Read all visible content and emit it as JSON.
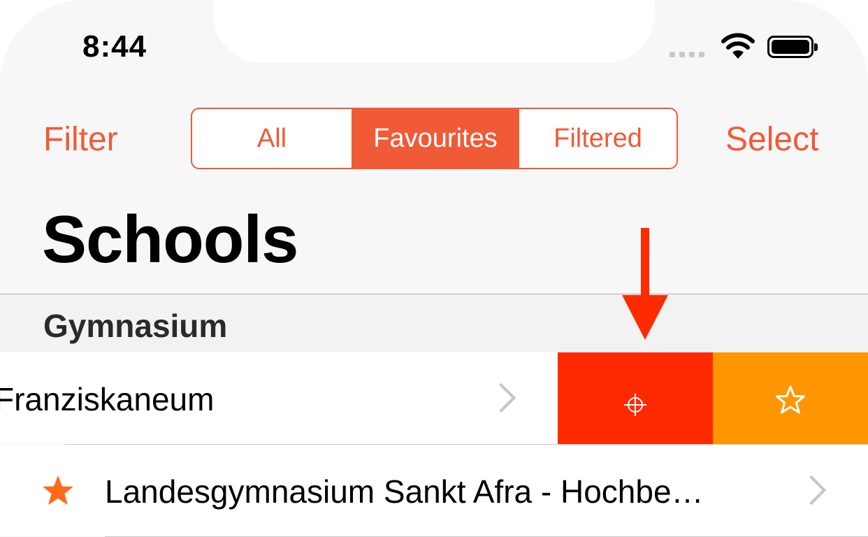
{
  "status_bar": {
    "time": "8:44"
  },
  "nav": {
    "left_button": "Filter",
    "right_button": "Select",
    "segments": [
      "All",
      "Favourites",
      "Filtered"
    ],
    "selected_segment": "Favourites"
  },
  "page": {
    "title": "Schools"
  },
  "section": {
    "header": "Gymnasium"
  },
  "rows": [
    {
      "label": "Franziskaneum",
      "favourite": false,
      "swiped": true
    },
    {
      "label": "Landesgymnasium Sankt Afra - Hochbe…",
      "favourite": true,
      "swiped": false
    }
  ],
  "swipe_actions": [
    {
      "icon": "crosshair-icon",
      "color": "#ff2a00"
    },
    {
      "icon": "star-outline-icon",
      "color": "#ff9500"
    }
  ],
  "colors": {
    "accent": "#f05a37",
    "favourite_star": "#ff6a1a",
    "annotation_arrow": "#ff2a00"
  }
}
